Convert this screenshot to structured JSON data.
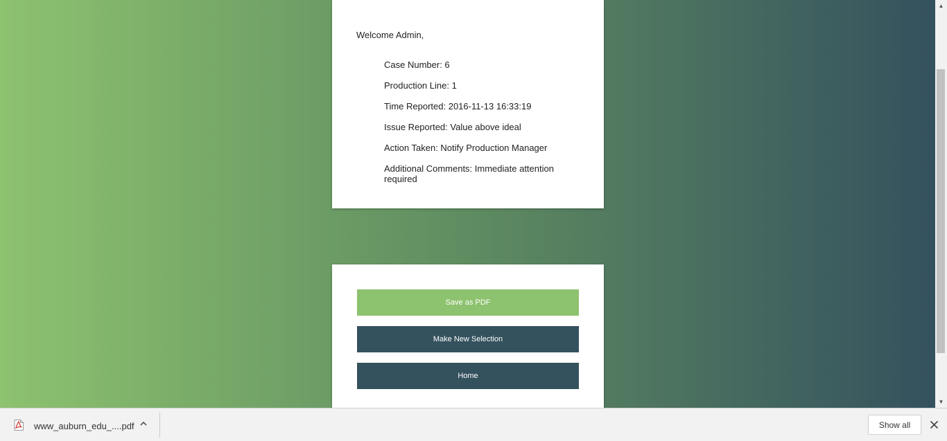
{
  "report": {
    "welcome": "Welcome Admin,",
    "fields": [
      {
        "label": "Case Number: 6"
      },
      {
        "label": "Production Line: 1"
      },
      {
        "label": "Time Reported: 2016-11-13 16:33:19"
      },
      {
        "label": "Issue Reported: Value above ideal"
      },
      {
        "label": "Action Taken: Notify Production Manager"
      },
      {
        "label": "Additional Comments: Immediate attention required"
      }
    ]
  },
  "actions": {
    "save_pdf": "Save as PDF",
    "new_selection": "Make New Selection",
    "home": "Home"
  },
  "download_bar": {
    "file_name": "www_auburn_edu_....pdf",
    "show_all": "Show all",
    "icons": {
      "file": "pdf-file-icon",
      "expand": "chevron-up-icon",
      "close": "close-icon"
    }
  },
  "colors": {
    "gradient_start": "#8dc26f",
    "gradient_end": "#34515e",
    "button_primary": "#8dc26f",
    "button_dark": "#34515e"
  }
}
